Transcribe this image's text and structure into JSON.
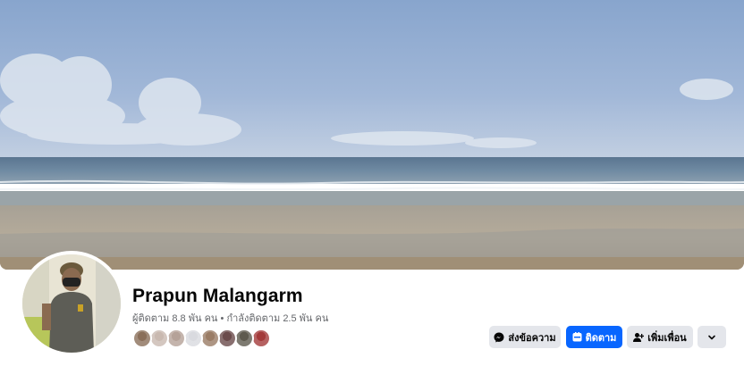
{
  "profile": {
    "name": "Prapun Malangarm",
    "followers_label": "ผู้ติดตาม",
    "followers_count": "8.8 พัน",
    "followers_unit": "คน",
    "separator": "•",
    "following_label": "กำลังติดตาม",
    "following_count": "2.5 พัน",
    "following_unit": "คน"
  },
  "friends_preview": {
    "colors": [
      "#8a6f5a",
      "#c9b9b0",
      "#b5a298",
      "#d9dadf",
      "#9a7c65",
      "#6b4b4b",
      "#5e5a4e",
      "#a33a3a"
    ],
    "count": 8
  },
  "actions": {
    "message_label": "ส่งข้อความ",
    "follow_label": "ติดตาม",
    "add_friend_label": "เพิ่มเพื่อน",
    "more_icon": "chevron-down-icon"
  },
  "colors": {
    "primary": "#0866ff",
    "secondary_bg": "#e4e6eb",
    "text": "#050505",
    "muted": "#65676b"
  }
}
